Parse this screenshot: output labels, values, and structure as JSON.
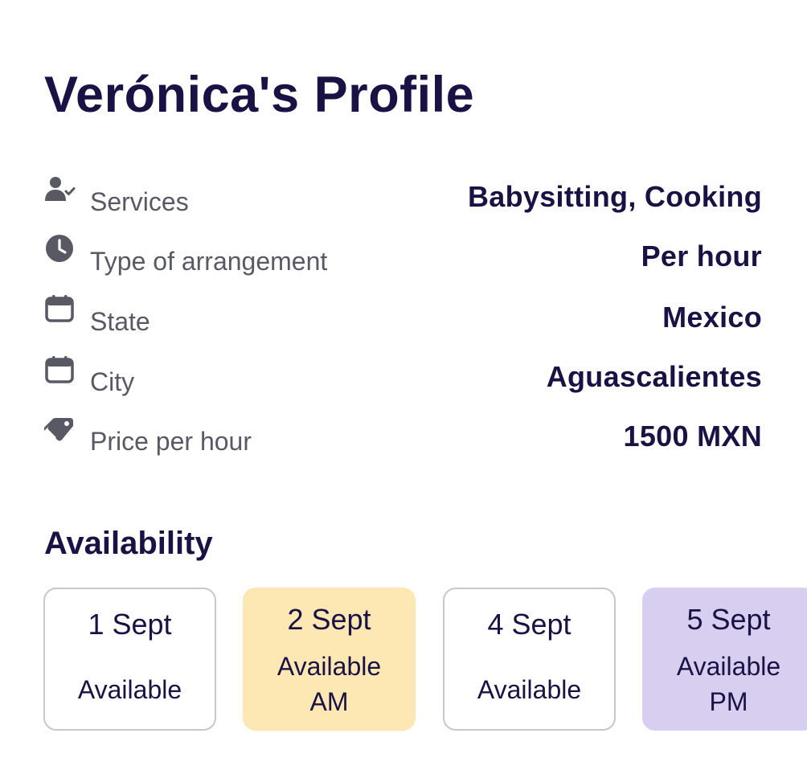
{
  "profile": {
    "title": "Verónica's Profile"
  },
  "details": [
    {
      "icon": "user-check-icon",
      "label": "Services",
      "value": "Babysitting, Cooking"
    },
    {
      "icon": "clock-icon",
      "label": "Type of arrangement",
      "value": "Per hour"
    },
    {
      "icon": "calendar-icon",
      "label": "State",
      "value": "Mexico"
    },
    {
      "icon": "calendar-icon",
      "label": "City",
      "value": "Aguascalientes"
    },
    {
      "icon": "price-tag-icon",
      "label": "Price per hour",
      "value": "1500 MXN"
    }
  ],
  "availability": {
    "title": "Availability",
    "days": [
      {
        "date": "1 Sept",
        "status": "Available",
        "variant": "plain"
      },
      {
        "date": "2 Sept",
        "status": "Available\nAM",
        "variant": "am",
        "color": "#fde8b4"
      },
      {
        "date": "4 Sept",
        "status": "Available",
        "variant": "plain"
      },
      {
        "date": "5 Sept",
        "status": "Available\nPM",
        "variant": "pm",
        "color": "#d8cff0"
      }
    ]
  },
  "colors": {
    "primary_text": "#1a1245",
    "secondary_text": "#595965",
    "icon": "#595965",
    "card_border": "#c7c7cc",
    "am_highlight": "#fde8b4",
    "pm_highlight": "#d8cff0"
  }
}
